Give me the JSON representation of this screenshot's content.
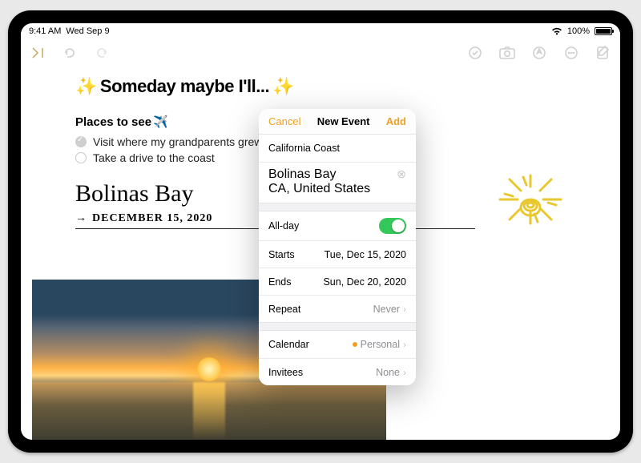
{
  "statusbar": {
    "time": "9:41 AM",
    "date": "Wed Sep 9",
    "battery": "100%"
  },
  "note": {
    "title": "Someday maybe I'll...",
    "section": "Places to see",
    "items": [
      {
        "label": "Visit where my grandparents grew up",
        "checked": true
      },
      {
        "label": "Take a drive to the coast",
        "checked": false
      }
    ],
    "hand1": "Bolinas Bay",
    "hand2": "DECEMBER 15, 2020"
  },
  "popover": {
    "cancel": "Cancel",
    "title": "New Event",
    "add": "Add",
    "event_title": "California Coast",
    "location_name": "Bolinas Bay",
    "location_sub": "CA, United States",
    "allday_label": "All-day",
    "starts_label": "Starts",
    "starts_value": "Tue, Dec 15, 2020",
    "ends_label": "Ends",
    "ends_value": "Sun, Dec 20, 2020",
    "repeat_label": "Repeat",
    "repeat_value": "Never",
    "calendar_label": "Calendar",
    "calendar_value": "Personal",
    "invitees_label": "Invitees",
    "invitees_value": "None"
  }
}
